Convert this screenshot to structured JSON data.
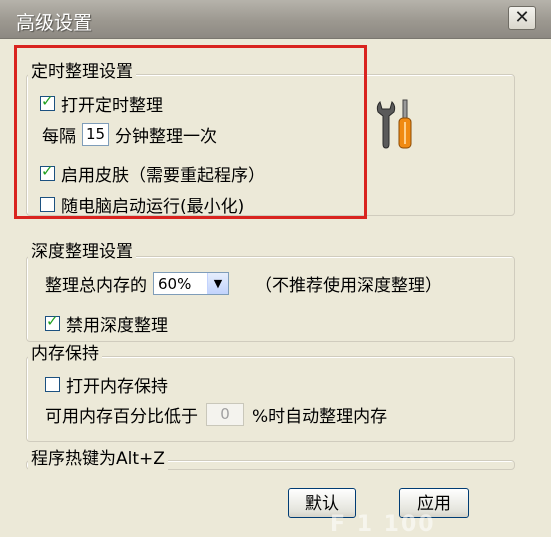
{
  "window": {
    "title": "高级设置",
    "close_glyph": "✕"
  },
  "timer_group": {
    "legend": "定时整理设置",
    "enable_label": "打开定时整理",
    "enable_checked": true,
    "interval_prefix": "每隔",
    "interval_value": "15",
    "interval_suffix": "分钟整理一次",
    "skin_label": "启用皮肤（需要重起程序）",
    "skin_checked": true,
    "startup_label": "随电脑启动运行(最小化)",
    "startup_checked": false
  },
  "deep_group": {
    "legend": "深度整理设置",
    "ratio_label": "整理总内存的",
    "ratio_value": "60%",
    "ratio_note": "（不推荐使用深度整理）",
    "disable_label": "禁用深度整理",
    "disable_checked": true
  },
  "keep_group": {
    "legend": "内存保持",
    "enable_label": "打开内存保持",
    "enable_checked": false,
    "threshold_prefix": "可用内存百分比低于",
    "threshold_value": "0",
    "threshold_suffix": "%时自动整理内存"
  },
  "hotkey": {
    "label": "程序热键为Alt+Z"
  },
  "buttons": {
    "default_label": "默认",
    "apply_label": "应用"
  },
  "icon": {
    "name": "tools-icon",
    "handle_color": "#f08a12"
  },
  "watermark": "F 1 100"
}
